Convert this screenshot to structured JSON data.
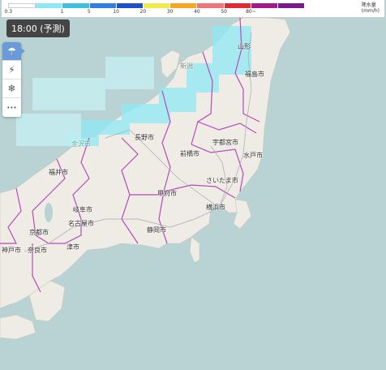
{
  "legend": {
    "colors": [
      "#ffffff",
      "#8ee9f5",
      "#3fc0df",
      "#2f7fe0",
      "#2050c8",
      "#f4e94a",
      "#f5a623",
      "#f0757a",
      "#e02b35",
      "#a21a8a",
      "#7a1a90"
    ],
    "ticks": [
      "0.3",
      "1",
      "5",
      "10",
      "20",
      "30",
      "40",
      "50",
      "80~"
    ],
    "unit_title": "降水量",
    "unit": "(mm/h)"
  },
  "time_label": "18:00 (予測)",
  "tools": [
    {
      "name": "rain-tool-icon",
      "glyph": "☂"
    },
    {
      "name": "lightning-tool-icon",
      "glyph": "⚡"
    },
    {
      "name": "snow-tool-icon",
      "glyph": "❄"
    },
    {
      "name": "more-tool-icon",
      "glyph": "•••"
    }
  ],
  "cities": {
    "yamagata": "山形",
    "niigata": "新潟",
    "fukushima": "福島市",
    "nagano": "長野市",
    "utsunomiya": "宇都宮市",
    "maebashi": "前橋市",
    "mito": "水戸市",
    "fukui": "福井市",
    "saitama": "さいたま市",
    "kofu": "甲府市",
    "yokohama": "横浜市",
    "gifu": "岐阜市",
    "nagoya": "名古屋市",
    "kyoto": "京都市",
    "shizuoka": "静岡市",
    "tsu": "津市",
    "kobe": "神戸市",
    "nara": "奈良市",
    "kanazawa": "金沢市"
  }
}
